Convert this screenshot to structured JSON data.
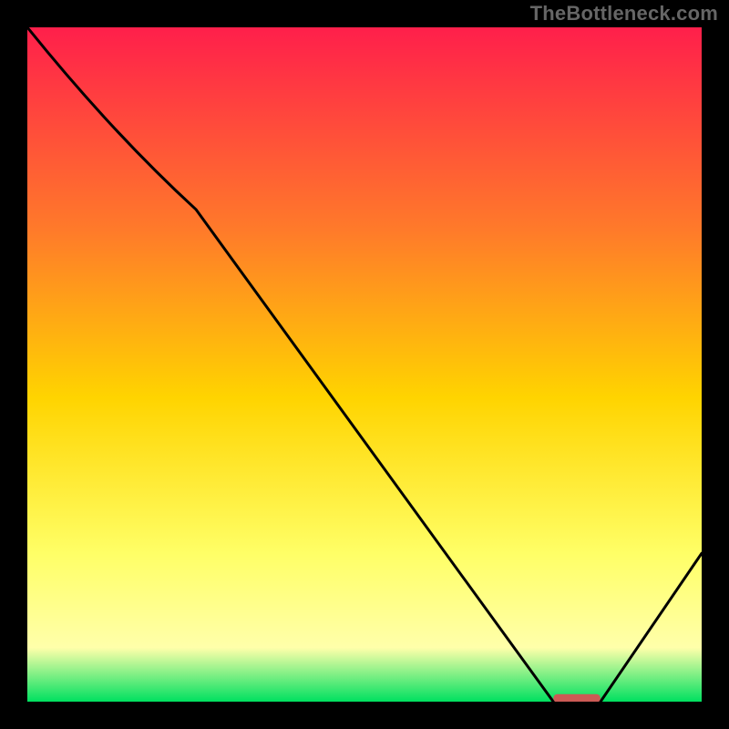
{
  "watermark": "TheBottleneck.com",
  "colors": {
    "border": "#000000",
    "line": "#000000",
    "marker": "#cc5a55",
    "grad_top": "#ff1f4b",
    "grad_mid1": "#ff7a2a",
    "grad_mid2": "#ffd400",
    "grad_mid3": "#ffff66",
    "grad_mid4": "#ffffaa",
    "grad_bottom": "#00e060"
  },
  "chart_data": {
    "type": "line",
    "title": "",
    "xlabel": "",
    "ylabel": "",
    "xlim": [
      0,
      100
    ],
    "ylim": [
      0,
      100
    ],
    "series": [
      {
        "name": "curve",
        "x": [
          0,
          25,
          78,
          85,
          100
        ],
        "values": [
          100,
          73,
          0,
          0,
          22
        ]
      }
    ],
    "markers": [
      {
        "name": "optimal-range",
        "x0": 78,
        "x1": 85,
        "y": 0.5
      }
    ]
  }
}
